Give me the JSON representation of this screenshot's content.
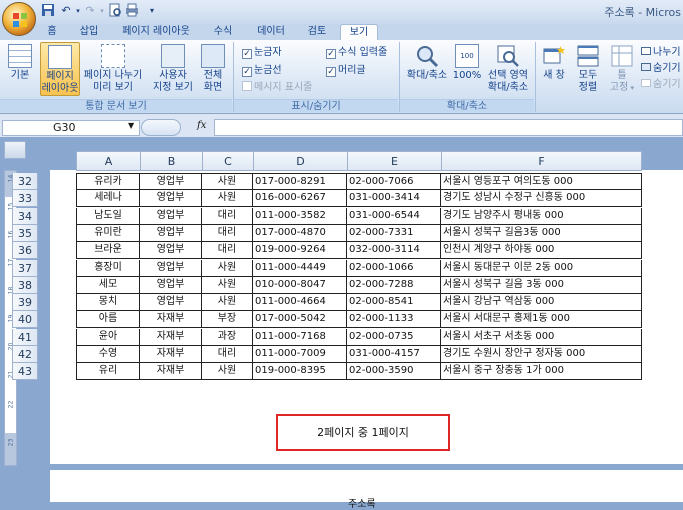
{
  "app": {
    "window_title": "주소록 - Micros"
  },
  "tabs": [
    {
      "label": "홈",
      "active": false
    },
    {
      "label": "삽입",
      "active": false
    },
    {
      "label": "페이지 레이아웃",
      "active": false
    },
    {
      "label": "수식",
      "active": false
    },
    {
      "label": "데이터",
      "active": false
    },
    {
      "label": "검토",
      "active": false
    },
    {
      "label": "보기",
      "active": true
    }
  ],
  "ribbon": {
    "workbook_views": {
      "normal": "기본",
      "page_layout_line1": "페이지",
      "page_layout_line2": "레이아웃",
      "page_break_line1": "페이지 나누기",
      "page_break_line2": "미리 보기",
      "custom_line1": "사용자",
      "custom_line2": "지정 보기",
      "fullscreen_line1": "전체",
      "fullscreen_line2": "화면",
      "group_label": "통합 문서 보기"
    },
    "show_hide": {
      "ruler": "눈금자",
      "formula_bar": "수식 입력줄",
      "gridlines": "눈금선",
      "headings": "머리글",
      "message_bar": "메시지 표시줄",
      "group_label": "표시/숨기기"
    },
    "zoom": {
      "zoom": "확대/축소",
      "hundred": "100%",
      "selection_line1": "선택 영역",
      "selection_line2": "확대/축소",
      "group_label": "확대/축소"
    },
    "window": {
      "new_window": "새 창",
      "arrange_line1": "모두",
      "arrange_line2": "정렬",
      "freeze_line1": "틀",
      "freeze_line2": "고정",
      "split": "나누기",
      "hide": "숨기기",
      "unhide": "숨기기"
    }
  },
  "formula_bar": {
    "name_box": "G30",
    "fx": "fx",
    "value": ""
  },
  "columns": [
    "A",
    "B",
    "C",
    "D",
    "E",
    "F"
  ],
  "rows": [
    {
      "num": "32",
      "name": "유리카",
      "dept": "영업부",
      "rank": "사원",
      "mobile": "017-000-8291",
      "phone": "02-000-7066",
      "address": "서울시 영등포구 여의도동 000"
    },
    {
      "num": "33",
      "name": "세레나",
      "dept": "영업부",
      "rank": "사원",
      "mobile": "016-000-6267",
      "phone": "031-000-3414",
      "address": "경기도 성남시 수정구 신흥동 000"
    },
    {
      "num": "34",
      "name": "남도일",
      "dept": "영업부",
      "rank": "대리",
      "mobile": "011-000-3582",
      "phone": "031-000-6544",
      "address": "경기도 남양주시 평내동 000"
    },
    {
      "num": "35",
      "name": "유미란",
      "dept": "영업부",
      "rank": "대리",
      "mobile": "017-000-4870",
      "phone": "02-000-7331",
      "address": "서울시 성북구 길음3동 000"
    },
    {
      "num": "36",
      "name": "브라운",
      "dept": "영업부",
      "rank": "대리",
      "mobile": "019-000-9264",
      "phone": "032-000-3114",
      "address": "인천시 계양구 하야동 000"
    },
    {
      "num": "37",
      "name": "홍장미",
      "dept": "영업부",
      "rank": "사원",
      "mobile": "011-000-4449",
      "phone": "02-000-1066",
      "address": "서울시 동대문구 이문 2동 000"
    },
    {
      "num": "38",
      "name": "세모",
      "dept": "영업부",
      "rank": "사원",
      "mobile": "010-000-8047",
      "phone": "02-000-7288",
      "address": "서울시 성북구 길음 3동 000"
    },
    {
      "num": "39",
      "name": "몽치",
      "dept": "영업부",
      "rank": "사원",
      "mobile": "011-000-4664",
      "phone": "02-000-8541",
      "address": "서울시 강남구 역삼동 000"
    },
    {
      "num": "40",
      "name": "아름",
      "dept": "자재부",
      "rank": "부장",
      "mobile": "017-000-5042",
      "phone": "02-000-1133",
      "address": "서울시 서대문구 홍제1동 000"
    },
    {
      "num": "41",
      "name": "윤아",
      "dept": "자재부",
      "rank": "과장",
      "mobile": "011-000-7168",
      "phone": "02-000-0735",
      "address": "서울시 서초구 서초동 000"
    },
    {
      "num": "42",
      "name": "수영",
      "dept": "자재부",
      "rank": "대리",
      "mobile": "011-000-7009",
      "phone": "031-000-4157",
      "address": "경기도 수원시 장안구 정자동 000"
    },
    {
      "num": "43",
      "name": "유리",
      "dept": "자재부",
      "rank": "사원",
      "mobile": "019-000-8395",
      "phone": "02-000-3590",
      "address": "서울시 중구 장충동 1가 000"
    }
  ],
  "footer": {
    "page_text": "2페이지 중 1페이지"
  },
  "page2": {
    "header_text": "주소록"
  },
  "ruler_marks": [
    "14",
    "15",
    "16",
    "17",
    "18",
    "19",
    "20",
    "21",
    "22",
    "23"
  ]
}
